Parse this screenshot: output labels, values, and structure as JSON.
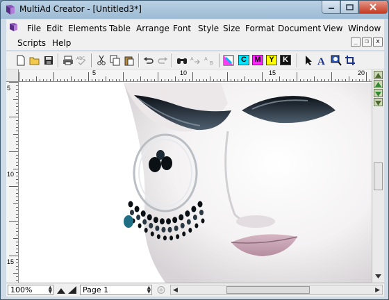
{
  "window": {
    "title": "MultiAd Creator - [Untitled3*]",
    "caption_buttons": {
      "minimize": "minimize-icon",
      "maximize": "maximize-icon",
      "close": "close-icon"
    }
  },
  "menubar": {
    "row1": [
      "File",
      "Edit",
      "Elements",
      "Table",
      "Arrange",
      "Font",
      "Style",
      "Size",
      "Format",
      "Document",
      "View",
      "Window"
    ],
    "row2": [
      "Scripts",
      "Help"
    ],
    "mdi_controls": [
      "_",
      "❐",
      "x"
    ]
  },
  "toolbar": {
    "buttons": [
      "new-document-icon",
      "open-folder-icon",
      "save-icon",
      "print-icon",
      "spell-check-icon",
      "cut-icon",
      "copy-icon",
      "paste-icon",
      "undo-icon",
      "redo-icon",
      "find-icon",
      "find-next-icon",
      "replace-icon",
      "color-mixer-icon",
      "pointer-tool-icon",
      "text-tool-icon",
      "zoom-tool-icon",
      "crop-tool-icon"
    ],
    "process_colors": [
      {
        "label": "C",
        "color": "#00e5ff"
      },
      {
        "label": "M",
        "color": "#ff22ff"
      },
      {
        "label": "Y",
        "color": "#ffff00"
      },
      {
        "label": "K",
        "color": "#111111"
      }
    ]
  },
  "rulers": {
    "horizontal_labels": [
      "5",
      "10",
      "15",
      "20"
    ],
    "vertical_labels": [
      "5",
      "10",
      "15"
    ]
  },
  "status": {
    "zoom": "100%",
    "page": "Page 1"
  }
}
